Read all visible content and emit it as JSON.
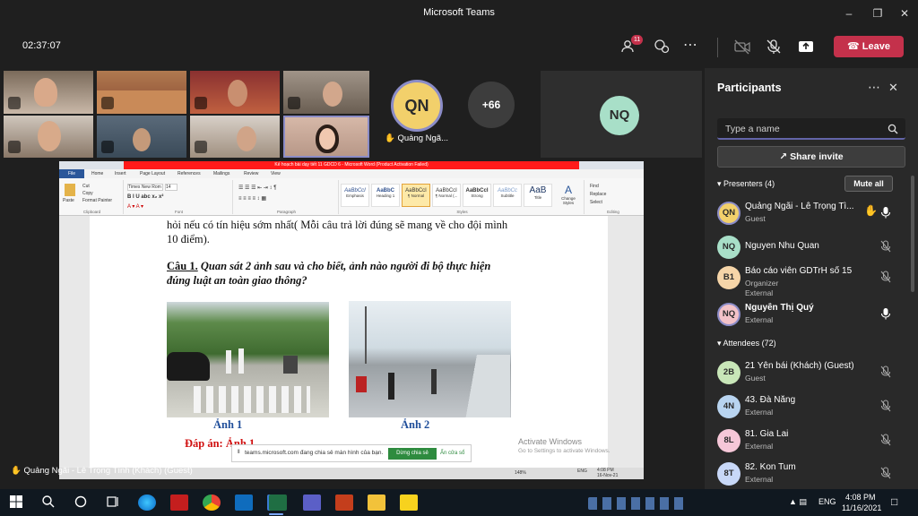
{
  "window": {
    "title": "Microsoft Teams"
  },
  "meeting": {
    "timer": "02:37:07",
    "participants_badge": "11",
    "leave_label": "Leave",
    "raised_hand_name": "Quảng Ngã...",
    "overflow_count": "+66",
    "tile_initials_qn": "QN",
    "tile_initials_nq": "NQ",
    "shared_by": "Quảng Ngãi - Lê Trọng Tình (Khách) (Guest)"
  },
  "word": {
    "title_bar": "Kế hoạch bài dạy tiết 11 GDCD 6 - Microsoft Word (Product Activation Failed)",
    "tabs": [
      "File",
      "Home",
      "Insert",
      "Page Layout",
      "References",
      "Mailings",
      "Review",
      "View"
    ],
    "clipboard": {
      "paste": "Paste",
      "cut": "Cut",
      "copy": "Copy",
      "painter": "Format Painter",
      "label": "Clipboard"
    },
    "font": {
      "name": "Times New Rom",
      "size": "14",
      "label": "Font"
    },
    "paragraph_label": "Paragraph",
    "styles": [
      {
        "sample": "AaBbCcI",
        "name": "Emphasis"
      },
      {
        "sample": "AaBbC",
        "name": "Heading 1"
      },
      {
        "sample": "AaBbCcI",
        "name": "¶ Normal"
      },
      {
        "sample": "AaBbCcI",
        "name": "¶ Normal (..."
      },
      {
        "sample": "AaBbCcI",
        "name": "Strong"
      },
      {
        "sample": "AaBbCc",
        "name": "Subtitle"
      },
      {
        "sample": "AaB",
        "name": "Title"
      }
    ],
    "styles_label": "Styles",
    "change_styles": "Change Styles",
    "editing": {
      "find": "Find",
      "replace": "Replace",
      "select": "Select",
      "label": "Editing"
    },
    "status_zoom": "148%",
    "status_time": "4:08 PM",
    "status_date": "16-Nov-21",
    "status_lang": "ENG"
  },
  "document": {
    "line1": "hỏi nếu có tín hiệu sớm nhất( Mỗi câu trả lời đúng sẽ mang về cho đội mình",
    "line2": "10 điểm).",
    "question_label": "Câu 1.",
    "question_text": "Quan sát 2 ảnh sau và cho biết, ảnh nào người đi bộ thực hiện",
    "question_text2": "đúng luật an toàn giao thông?",
    "caption1": "Ảnh 1",
    "caption2": "Ảnh 2",
    "answer": "Đáp án: Ảnh 1"
  },
  "share_notice": {
    "text": "teams.microsoft.com đang chia sẻ màn hình của bạn.",
    "share_button": "Dừng chia sẻ",
    "hide_button": "Ẩn cửa sổ"
  },
  "activate": {
    "title": "Activate Windows",
    "subtitle": "Go to Settings to activate Windows."
  },
  "participants_panel": {
    "title": "Participants",
    "search_placeholder": "Type a name",
    "share_invite": "Share invite",
    "presenters_header": "Presenters (4)",
    "mute_all": "Mute all",
    "attendees_header": "Attendees (72)",
    "presenters": [
      {
        "initials": "QN",
        "name": "Quảng Ngãi - Lê Trọng Tì...",
        "role": "Guest",
        "color": "#f2d06b"
      },
      {
        "initials": "NQ",
        "name": "Nguyen Nhu Quan",
        "role": "",
        "color": "#a8dfc8"
      },
      {
        "initials": "B1",
        "name": "Báo cáo viên GDTrH số 15",
        "role": "Organizer",
        "role2": "External",
        "color": "#f6d5a8"
      },
      {
        "initials": "NQ",
        "name": "Nguyễn Thị Quý",
        "role": "External",
        "color": "#f3c2c8"
      }
    ],
    "attendees": [
      {
        "initials": "2B",
        "name": "21 Yên bái (Khách) (Guest)",
        "role": "Guest",
        "color": "#c8e6b8"
      },
      {
        "initials": "4N",
        "name": "43. Đà Nẵng",
        "role": "External",
        "color": "#b8d4f0"
      },
      {
        "initials": "8L",
        "name": "81. Gia Lai",
        "role": "External",
        "color": "#f6c7d8"
      },
      {
        "initials": "8T",
        "name": "82. Kon Tum",
        "role": "External",
        "color": "#c8d8f8"
      }
    ]
  },
  "taskbar": {
    "lang": "ENG",
    "time": "4:08 PM",
    "date": "11/16/2021"
  },
  "colors": {
    "accent": "#6264a7",
    "leave": "#c4314b",
    "titlebar": "#1f1f1f"
  }
}
